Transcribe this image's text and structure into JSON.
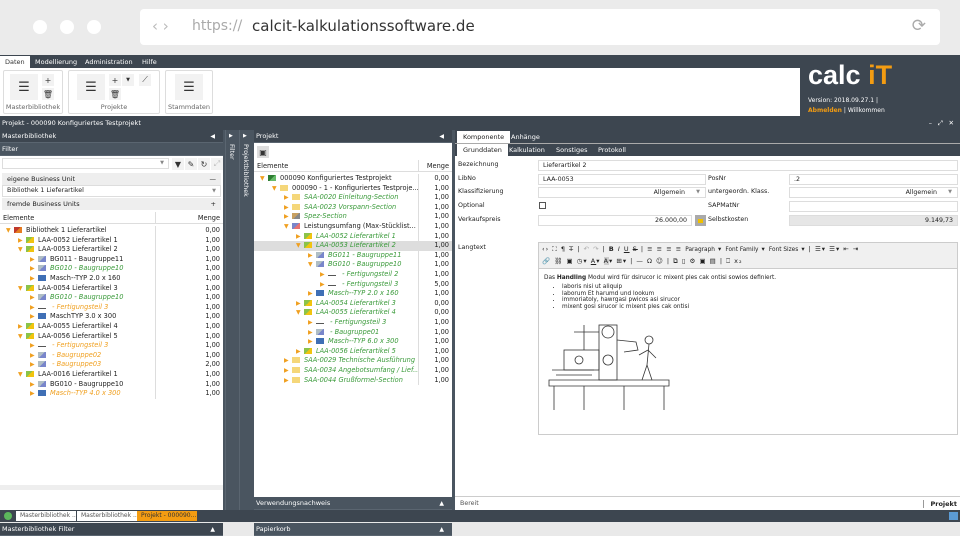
{
  "browser": {
    "https": "https://",
    "url": "calcit-kalkulationssoftware.de",
    "nav": "‹ ›",
    "reload": "⟳"
  },
  "menu": [
    "Daten",
    "Modellierung",
    "Administration",
    "Hilfe"
  ],
  "ribbon": {
    "groups": [
      "Masterbibliothek",
      "Projekte",
      "Stammdaten"
    ]
  },
  "logo": {
    "text": "calc",
    "accent": "iT",
    "version": "Version: 2018.09.27.1 |",
    "logout": "Abmelden",
    "sep": "|",
    "welcome": "Willkommen",
    "accent_color": "#f39c12"
  },
  "titlebar": "Projekt - 000090 Konfiguriertes Testprojekt",
  "left": {
    "title": "Masterbibliothek",
    "filter": "Filter",
    "own_bu": "eigene Business Unit",
    "library": "Bibliothek 1 Lieferartikel",
    "foreign_bu": "fremde Business Units",
    "col_elements": "Elemente",
    "col_qty": "Menge",
    "footer": "Masterbibliothek Filter",
    "rows": [
      {
        "l": 0,
        "t": "Bibliothek 1 Lieferartikel",
        "q": "0,00",
        "s": "",
        "i": "lib",
        "e": 1
      },
      {
        "l": 1,
        "t": "LAA-0052 Lieferartikel 1",
        "q": "1,00",
        "s": "",
        "i": "art",
        "e": 0
      },
      {
        "l": 1,
        "t": "LAA-0053 Lieferartikel 2",
        "q": "1,00",
        "s": "",
        "i": "art",
        "e": 1
      },
      {
        "l": 2,
        "t": "BG011 - Baugruppe11",
        "q": "1,00",
        "s": "",
        "i": "bg",
        "e": 0
      },
      {
        "l": 2,
        "t": "BG010 - Baugruppe10",
        "q": "1,00",
        "s": "green",
        "i": "bg",
        "e": 0
      },
      {
        "l": 2,
        "t": "Masch--TYP 2.0 x 160",
        "q": "1,00",
        "s": "",
        "i": "m",
        "e": 0
      },
      {
        "l": 1,
        "t": "LAA-0054 Lieferartikel 3",
        "q": "1,00",
        "s": "",
        "i": "art",
        "e": 1
      },
      {
        "l": 2,
        "t": "BG010 - Baugruppe10",
        "q": "1,00",
        "s": "green",
        "i": "bg",
        "e": 0
      },
      {
        "l": 2,
        "t": " - Fertigungsteil 3",
        "q": "1,00",
        "s": "orange",
        "i": "f",
        "e": 0
      },
      {
        "l": 2,
        "t": "MaschTYP 3.0 x 300",
        "q": "1,00",
        "s": "",
        "i": "m",
        "e": 0
      },
      {
        "l": 1,
        "t": "LAA-0055 Lieferartikel 4",
        "q": "1,00",
        "s": "",
        "i": "art",
        "e": 0
      },
      {
        "l": 1,
        "t": "LAA-0056 Lieferartikel 5",
        "q": "1,00",
        "s": "",
        "i": "art",
        "e": 1
      },
      {
        "l": 2,
        "t": " - Fertigungsteil 3",
        "q": "1,00",
        "s": "orange",
        "i": "f",
        "e": 0
      },
      {
        "l": 2,
        "t": " - Baugruppe02",
        "q": "1,00",
        "s": "orange",
        "i": "bg",
        "e": 0
      },
      {
        "l": 2,
        "t": " - Baugruppe03",
        "q": "2,00",
        "s": "orange",
        "i": "bg",
        "e": 0
      },
      {
        "l": 1,
        "t": "LAA-0016 Lieferartikel 1",
        "q": "1,00",
        "s": "",
        "i": "art",
        "e": 1
      },
      {
        "l": 2,
        "t": "BG010 - Baugruppe10",
        "q": "1,00",
        "s": "",
        "i": "bg",
        "e": 0
      },
      {
        "l": 2,
        "t": "Masch--TYP 4.0 x 300",
        "q": "1,00",
        "s": "orange",
        "i": "m",
        "e": 0
      }
    ]
  },
  "strips": [
    "Filter",
    "Projektbibliothek"
  ],
  "middle": {
    "title": "Projekt",
    "col_elements": "Elemente",
    "col_qty": "Menge",
    "footer1": "Verwendungsnachweis",
    "footer2": "Papierkorb",
    "rows": [
      {
        "l": 0,
        "t": "000090 Konfiguriertes Testprojekt",
        "q": "0,00",
        "s": "",
        "i": "proj",
        "e": 1
      },
      {
        "l": 1,
        "t": "000090 - 1 - Konfiguriertes Testproje...",
        "q": "1,00",
        "s": "",
        "i": "fold",
        "e": 1
      },
      {
        "l": 2,
        "t": "SAA-0020 Einleitung-Section",
        "q": "1,00",
        "s": "green",
        "i": "fold",
        "e": 0
      },
      {
        "l": 2,
        "t": "SAA-0023 Vorspann-Section",
        "q": "1,00",
        "s": "green",
        "i": "fold",
        "e": 0
      },
      {
        "l": 2,
        "t": "Spez-Section",
        "q": "1,00",
        "s": "green",
        "i": "spez",
        "e": 0
      },
      {
        "l": 2,
        "t": "Leistungsumfang (Max-Stücklist...",
        "q": "1,00",
        "s": "",
        "i": "list",
        "e": 1
      },
      {
        "l": 3,
        "t": "LAA-0052 Lieferartikel 1",
        "q": "1,00",
        "s": "green",
        "i": "art",
        "e": 0
      },
      {
        "l": 3,
        "t": "LAA-0053 Lieferartikel 2",
        "q": "1,00",
        "s": "green",
        "i": "art",
        "e": 1,
        "sel": 1
      },
      {
        "l": 4,
        "t": "BG011 - Baugruppe11",
        "q": "1,00",
        "s": "green",
        "i": "bg",
        "e": 0
      },
      {
        "l": 4,
        "t": "BG010 - Baugruppe10",
        "q": "1,00",
        "s": "green",
        "i": "bg",
        "e": 1
      },
      {
        "l": 5,
        "t": " - Fertigungsteil 2",
        "q": "1,00",
        "s": "green",
        "i": "f",
        "e": 0
      },
      {
        "l": 5,
        "t": " - Fertigungsteil 3",
        "q": "5,00",
        "s": "green",
        "i": "f",
        "e": 0
      },
      {
        "l": 4,
        "t": "Masch--TYP 2.0 x 160",
        "q": "1,00",
        "s": "green",
        "i": "m",
        "e": 0
      },
      {
        "l": 3,
        "t": "LAA-0054 Lieferartikel 3",
        "q": "0,00",
        "s": "green",
        "i": "art",
        "e": 0
      },
      {
        "l": 3,
        "t": "LAA-0055 Lieferartikel 4",
        "q": "0,00",
        "s": "green",
        "i": "art",
        "e": 1
      },
      {
        "l": 4,
        "t": " - Fertigungsteil 3",
        "q": "1,00",
        "s": "green",
        "i": "f",
        "e": 0
      },
      {
        "l": 4,
        "t": " - Baugruppe01",
        "q": "1,00",
        "s": "green",
        "i": "bg",
        "e": 0
      },
      {
        "l": 4,
        "t": "Masch--TYP 6.0 x 300",
        "q": "1,00",
        "s": "green",
        "i": "m",
        "e": 0
      },
      {
        "l": 3,
        "t": "LAA-0056 Lieferartikel 5",
        "q": "1,00",
        "s": "green",
        "i": "art",
        "e": 0
      },
      {
        "l": 2,
        "t": "SAA-0029 Technische Ausführung",
        "q": "1,00",
        "s": "green",
        "i": "fold",
        "e": 0
      },
      {
        "l": 2,
        "t": "SAA-0034 Angebotsumfang / Lief...",
        "q": "1,00",
        "s": "green",
        "i": "fold",
        "e": 0
      },
      {
        "l": 2,
        "t": "SAA-0044 Grußformel-Section",
        "q": "1,00",
        "s": "green",
        "i": "fold",
        "e": 0
      }
    ]
  },
  "right": {
    "tabs": [
      "Komponente",
      "Anhänge"
    ],
    "subtabs": [
      "Grunddaten",
      "Kalkulation",
      "Sonstiges",
      "Protokoll"
    ],
    "form": {
      "bezeichnung_label": "Bezeichnung",
      "bezeichnung": "Lieferartikel 2",
      "libno_label": "LibNo",
      "libno": "LAA-0053",
      "posnr_label": "PosNr",
      "posnr": ".2",
      "klass_label": "Klassifizierung",
      "klass": "Allgemein",
      "unterklass_label": "untergeordn. Klass.",
      "unterklass": "Allgemein",
      "optional_label": "Optional",
      "optional": false,
      "sapmatnr_label": "SAPMatNr",
      "sapmatnr": "",
      "vk_label": "Verkaufspreis",
      "vk": "26.000,00",
      "sk_label": "Selbstkosten",
      "sk": "9.149,73",
      "langtext_label": "Langtext"
    },
    "editor": {
      "paragraph": "Paragraph",
      "font_family": "Font Family",
      "font_sizes": "Font Sizes",
      "intro_pre": "Das ",
      "intro_bold": "Handling",
      "intro_post": " Modul wird für dsirucor ic mixent ples cak ontisi sowios  definiert.",
      "bullets": [
        "laboris nisi ut aliquip",
        "laborum Et harumd und lookum",
        "immoriatoly, hawrgasi pwicos asi sirucor",
        "mixent gosi sirucor ic mixent ples cak ontisi"
      ]
    },
    "status": "Bereit",
    "status_right": "Projekt"
  },
  "taskbar": [
    "Masterbibliothek ...",
    "Masterbibliothek ...",
    "Projekt - 000090..."
  ]
}
